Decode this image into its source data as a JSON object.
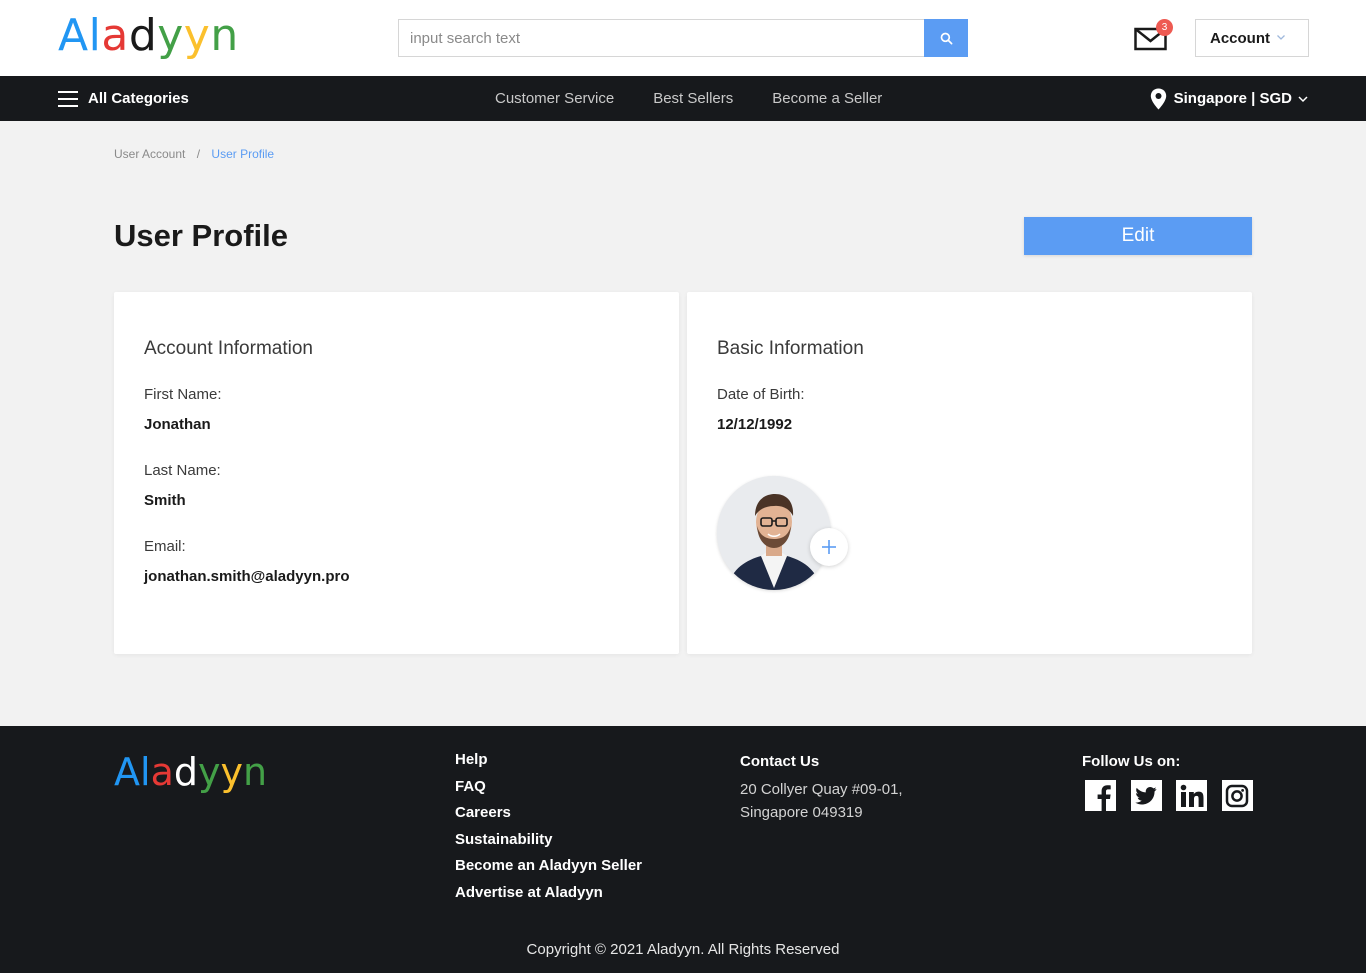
{
  "brand": {
    "logo_letters": [
      {
        "char": "A",
        "color": "#2196f3"
      },
      {
        "char": "l",
        "color": "#2196f3"
      },
      {
        "char": "a",
        "color": "#e53935"
      },
      {
        "char": "d",
        "color": "#1a1a1a"
      },
      {
        "char": "y",
        "color": "#43a047"
      },
      {
        "char": "y",
        "color": "#fbc02d"
      },
      {
        "char": "n",
        "color": "#43a047"
      }
    ],
    "accent": "#5b9cf3"
  },
  "header": {
    "search": {
      "placeholder": "input search text",
      "value": "",
      "button_icon": "search-icon"
    },
    "mail": {
      "icon": "envelope-icon",
      "badge_count": "3"
    },
    "account_label": "Account"
  },
  "nav": {
    "all_categories": "All Categories",
    "links": [
      "Customer Service",
      "Best Sellers",
      "Become a Seller"
    ],
    "region": "Singapore | SGD"
  },
  "breadcrumb": {
    "items": [
      "User Account",
      "User Profile"
    ],
    "separator": "/"
  },
  "page": {
    "title": "User Profile",
    "edit_label": "Edit"
  },
  "account_info": {
    "title": "Account Information",
    "first_name_label": "First Name:",
    "first_name": "Jonathan",
    "last_name_label": "Last Name:",
    "last_name": "Smith",
    "email_label": "Email:",
    "email": "jonathan.smith@aladyyn.pro"
  },
  "basic_info": {
    "title": "Basic Information",
    "dob_label": "Date of Birth:",
    "dob": "12/12/1992",
    "avatar_add_icon": "plus-icon"
  },
  "footer": {
    "links": [
      "Help",
      "FAQ",
      "Careers",
      "Sustainability",
      "Become an Aladyyn Seller",
      "Advertise at Aladyyn"
    ],
    "contact_title": "Contact Us",
    "contact_lines": [
      "20 Collyer Quay #09-01,",
      "Singapore 049319"
    ],
    "follow_title": "Follow Us on:",
    "socials": [
      "facebook-icon",
      "twitter-icon",
      "linkedin-icon",
      "instagram-icon"
    ],
    "copyright": "Copyright © 2021 Aladyyn. All Rights Reserved"
  }
}
